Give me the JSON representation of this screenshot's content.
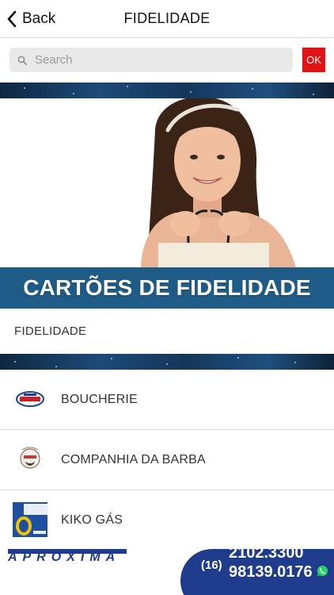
{
  "header": {
    "back_label": "Back",
    "title": "FIDELIDADE"
  },
  "search": {
    "placeholder": "Search",
    "value": "",
    "ok_label": "OK"
  },
  "banner": {
    "title": "CARTÕES DE FIDELIDADE"
  },
  "section": {
    "label": "FIDELIDADE"
  },
  "list": [
    {
      "label": "BOUCHERIE",
      "icon": "boucherie-logo"
    },
    {
      "label": "COMPANHIA DA BARBA",
      "icon": "companhia-da-barba-logo"
    },
    {
      "label": "KIKO GÁS",
      "icon": "kiko-gas-logo"
    }
  ],
  "ad": {
    "tagline": "APROXIMA",
    "area_code": "(16)",
    "phone1": "2102.3300",
    "phone2": "98139.0176",
    "icon": "whatsapp-icon"
  },
  "colors": {
    "ok_button": "#e01414",
    "banner_blue": "#1f5b87",
    "ad_blue": "#1f3b8c"
  }
}
